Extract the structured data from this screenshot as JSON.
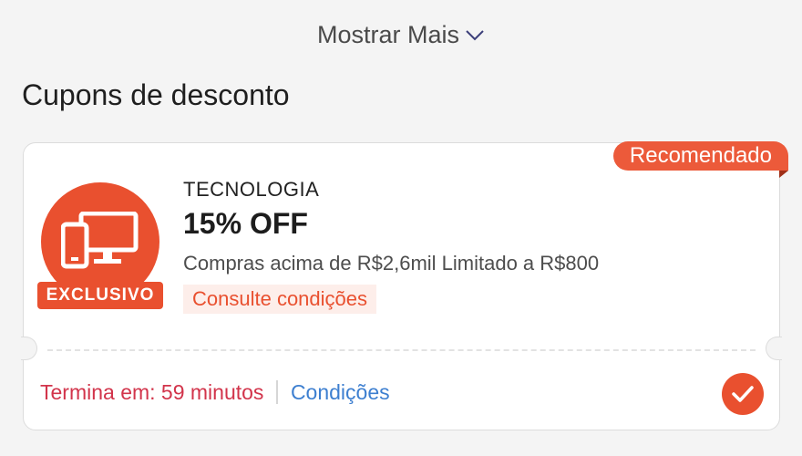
{
  "show_more": {
    "label": "Mostrar Mais",
    "icon": "chevron-down-icon"
  },
  "section": {
    "title": "Cupons de desconto"
  },
  "coupon": {
    "badge": "Recomendado",
    "icon": "devices-icon",
    "tag": "EXCLUSIVO",
    "category": "TECNOLOGIA",
    "discount": "15% OFF",
    "details": "Compras acima de R$2,6mil Limitado a R$800",
    "consult_link": "Consulte condições",
    "expires": "Termina em: 59 minutos",
    "conditions_link": "Condições",
    "selected": true
  },
  "colors": {
    "accent": "#e9502f",
    "badge": "#ec5a3a",
    "expires": "#d2344b",
    "link": "#3d7fd0"
  }
}
